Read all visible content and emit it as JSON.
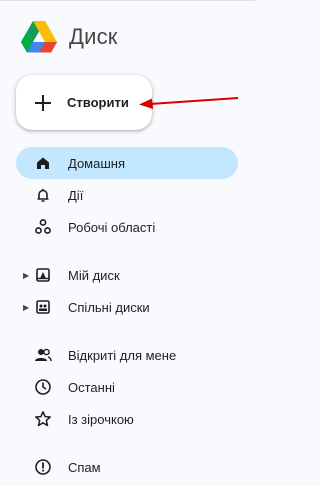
{
  "app": {
    "title": "Диск"
  },
  "new_button": {
    "label": "Створити"
  },
  "sidebar": {
    "items": [
      {
        "label": "Домашня",
        "icon": "home-icon",
        "active": true
      },
      {
        "label": "Дії",
        "icon": "bell-icon"
      },
      {
        "label": "Робочі області",
        "icon": "workspaces-icon"
      },
      {
        "label": "Мій диск",
        "icon": "my-drive-icon",
        "expandable": true
      },
      {
        "label": "Спільні диски",
        "icon": "shared-drives-icon",
        "expandable": true
      },
      {
        "label": "Відкриті для мене",
        "icon": "people-icon"
      },
      {
        "label": "Останні",
        "icon": "clock-icon"
      },
      {
        "label": "Із зірочкою",
        "icon": "star-icon"
      },
      {
        "label": "Спам",
        "icon": "spam-icon"
      }
    ]
  },
  "colors": {
    "active_bg": "#c2e7ff",
    "annotation_arrow": "#d50000"
  }
}
